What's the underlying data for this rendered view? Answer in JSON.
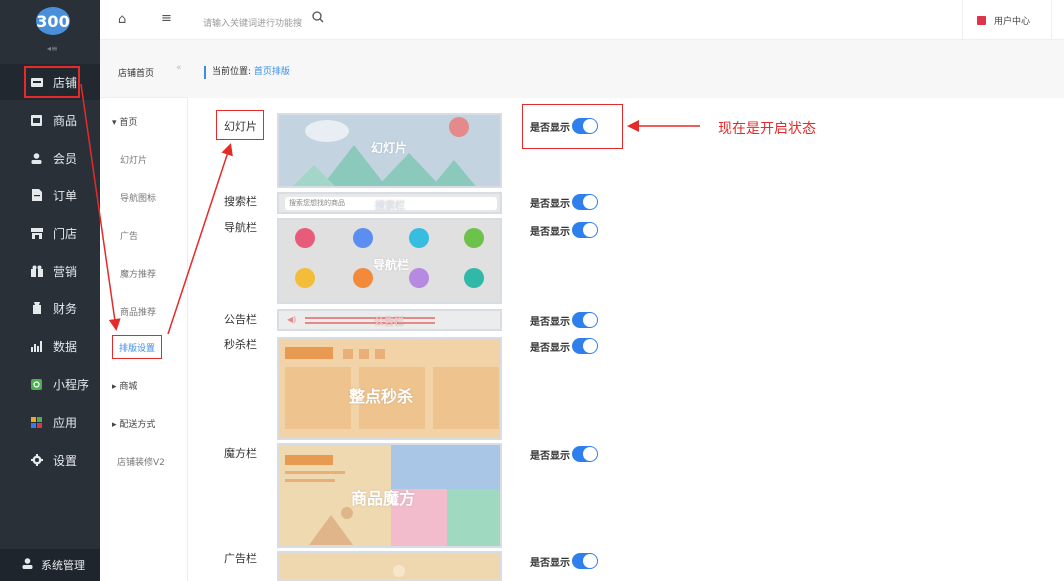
{
  "logo": "300",
  "sidebar": {
    "items": [
      {
        "label": "店铺",
        "icon": "store-icon"
      },
      {
        "label": "商品",
        "icon": "goods-icon"
      },
      {
        "label": "会员",
        "icon": "member-icon"
      },
      {
        "label": "订单",
        "icon": "order-icon"
      },
      {
        "label": "门店",
        "icon": "shop-icon"
      },
      {
        "label": "营销",
        "icon": "marketing-icon"
      },
      {
        "label": "财务",
        "icon": "finance-icon"
      },
      {
        "label": "数据",
        "icon": "data-icon"
      },
      {
        "label": "小程序",
        "icon": "miniapp-icon"
      },
      {
        "label": "应用",
        "icon": "apps-icon"
      },
      {
        "label": "设置",
        "icon": "gear-icon"
      }
    ],
    "system": "系统管理"
  },
  "subnav": {
    "title": "店铺首页",
    "items": [
      {
        "label": "▾ 首页"
      },
      {
        "label": "幻灯片"
      },
      {
        "label": "导航图标"
      },
      {
        "label": "广告"
      },
      {
        "label": "魔方推荐"
      },
      {
        "label": "商品推荐"
      },
      {
        "label": "排版设置"
      },
      {
        "label": "▸ 商城"
      },
      {
        "label": "▸ 配送方式"
      },
      {
        "label": "店铺装修V2"
      }
    ]
  },
  "topbar": {
    "search_placeholder": "请输入关键词进行功能搜",
    "user_center": "用户中心"
  },
  "breadcrumb": {
    "prefix": "当前位置:",
    "current": "首页排版"
  },
  "rows": {
    "slideshow": "幻灯片",
    "searchbar": "搜索栏",
    "navbar": "导航栏",
    "notice": "公告栏",
    "seckill": "秒杀栏",
    "cube": "魔方栏",
    "ad": "广告栏"
  },
  "toggle_label": "是否显示",
  "annotation": "现在是开启状态",
  "preview": {
    "slideshow": "幻灯片",
    "search_ph": "搜索您想找的商品",
    "search": "搜索栏",
    "nav": "导航栏",
    "notice": "公告栏",
    "seckill": "整点秒杀",
    "cube": "商品魔方"
  },
  "colors": {
    "sidebar_bg": "#293038",
    "accent": "#2f80ed",
    "highlight": "#e52a2a"
  }
}
